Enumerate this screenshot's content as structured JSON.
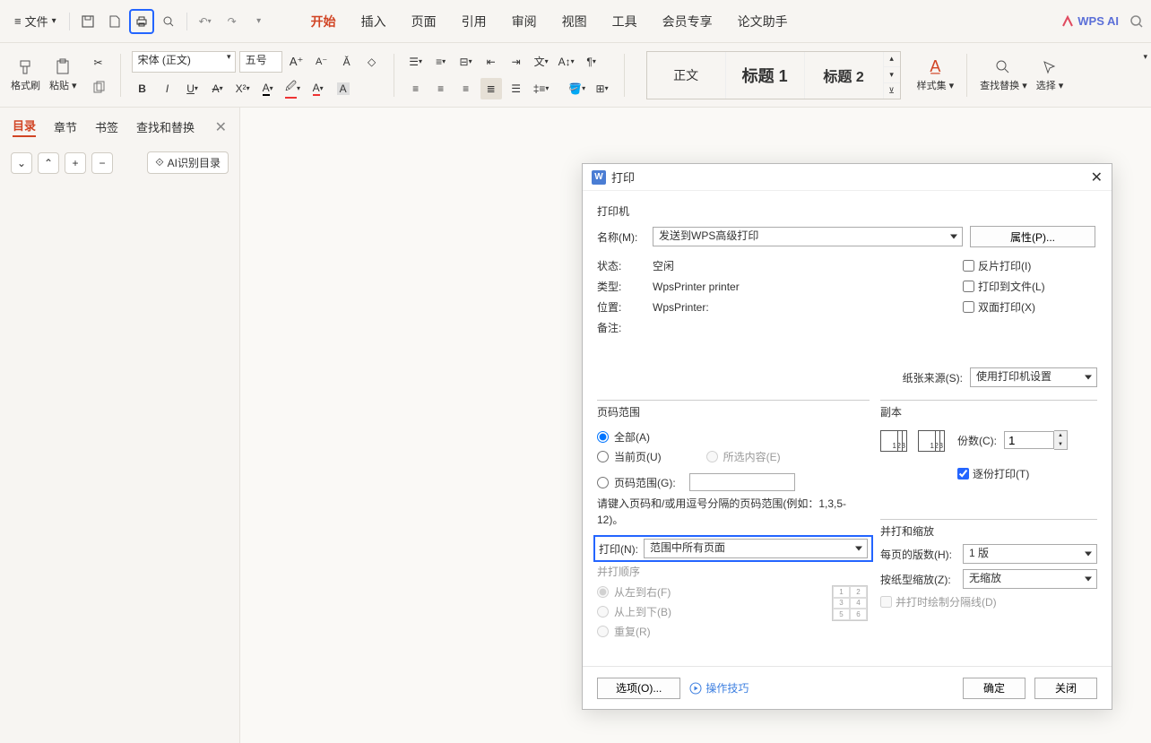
{
  "topbar": {
    "file": "文件"
  },
  "menu": {
    "start": "开始",
    "insert": "插入",
    "page": "页面",
    "ref": "引用",
    "review": "审阅",
    "view": "视图",
    "tools": "工具",
    "member": "会员专享",
    "paper": "论文助手"
  },
  "wps_ai": "WPS AI",
  "ribbon": {
    "format_painter": "格式刷",
    "paste": "粘贴",
    "font": "宋体 (正文)",
    "size": "五号",
    "styles": {
      "body": "正文",
      "h1": "标题 1",
      "h2": "标题 2"
    },
    "styleset": "样式集",
    "findrep": "查找替换",
    "select": "选择"
  },
  "sidepanel": {
    "tabs": {
      "toc": "目录",
      "chapter": "章节",
      "bookmark": "书签",
      "findrep": "查找和替换"
    },
    "ai_outline": "AI识别目录"
  },
  "dialog": {
    "title": "打印",
    "printer_section": "打印机",
    "name_lbl": "名称(M):",
    "name_val": "发送到WPS高级打印",
    "props_btn": "属性(P)...",
    "status_lbl": "状态:",
    "status_val": "空闲",
    "type_lbl": "类型:",
    "type_val": "WpsPrinter printer",
    "loc_lbl": "位置:",
    "loc_val": "WpsPrinter:",
    "note_lbl": "备注:",
    "chk_reverse": "反片打印(I)",
    "chk_tofile": "打印到文件(L)",
    "chk_duplex": "双面打印(X)",
    "paper_src_lbl": "纸张来源(S):",
    "paper_src_val": "使用打印机设置",
    "range_section": "页码范围",
    "r_all": "全部(A)",
    "r_current": "当前页(U)",
    "r_sel": "所选内容(E)",
    "r_range": "页码范围(G):",
    "range_hint": "请键入页码和/或用逗号分隔的页码范围(例如：1,3,5-12)。",
    "printn_lbl": "打印(N):",
    "printn_val": "范围中所有页面",
    "order_section": "并打顺序",
    "o_lr": "从左到右(F)",
    "o_tb": "从上到下(B)",
    "o_rep": "重复(R)",
    "copy_section": "副本",
    "copies_lbl": "份数(C):",
    "copies_val": "1",
    "collate": "逐份打印(T)",
    "scale_section": "并打和缩放",
    "perpage_lbl": "每页的版数(H):",
    "perpage_val": "1 版",
    "scale_lbl": "按纸型缩放(Z):",
    "scale_val": "无缩放",
    "drawborder": "并打时绘制分隔线(D)",
    "options_btn": "选项(O)...",
    "tips": "操作技巧",
    "ok": "确定",
    "close": "关闭"
  }
}
